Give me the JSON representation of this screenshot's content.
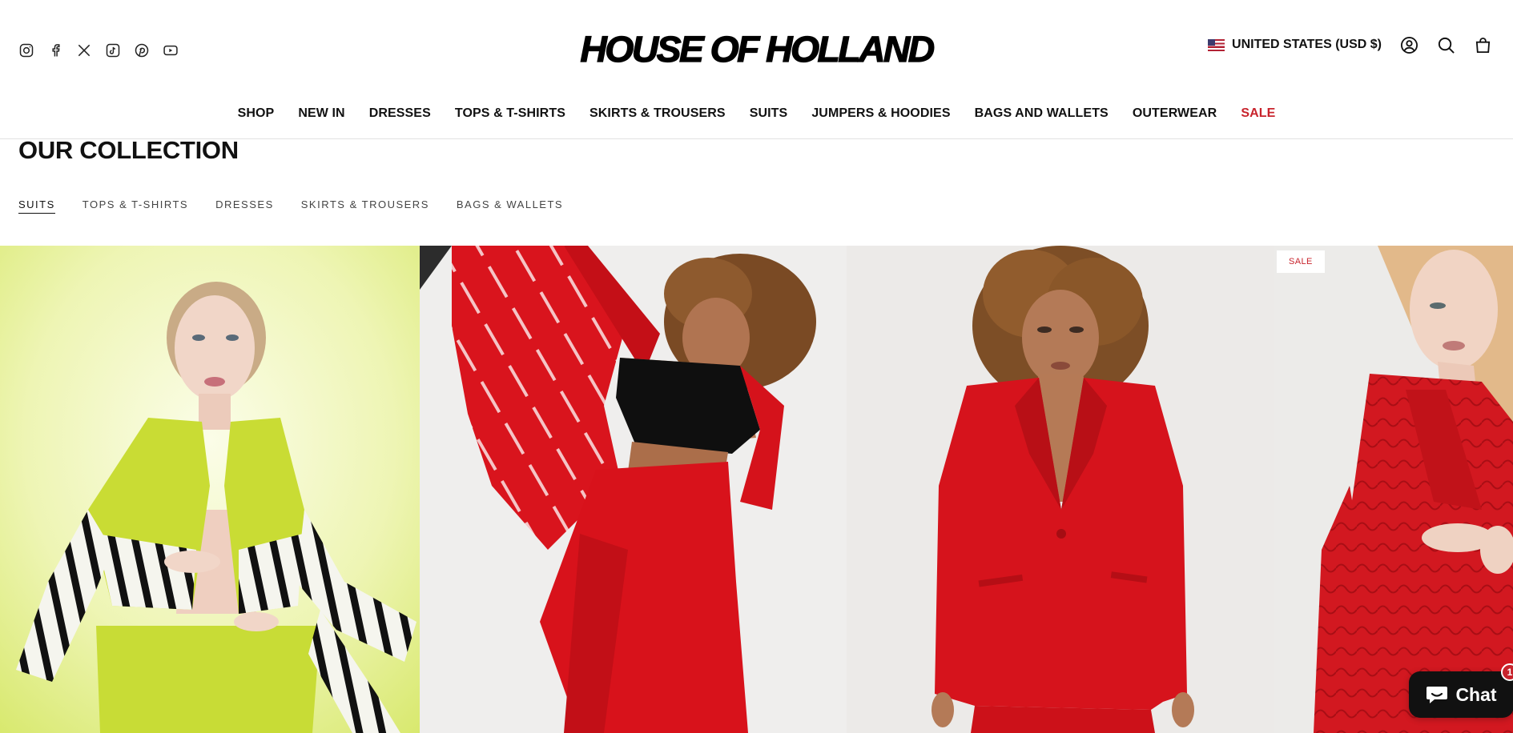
{
  "header": {
    "logo_text": "HOUSE OF HOLLAND",
    "socials": [
      "instagram-icon",
      "facebook-icon",
      "x-icon",
      "tiktok-icon",
      "pinterest-icon",
      "youtube-icon"
    ],
    "country_label": "UNITED STATES (USD $)",
    "utility_icons": [
      "account-icon",
      "search-icon",
      "cart-icon"
    ],
    "nav": [
      {
        "label": "SHOP"
      },
      {
        "label": "NEW IN"
      },
      {
        "label": "DRESSES"
      },
      {
        "label": "TOPS & T-SHIRTS"
      },
      {
        "label": "SKIRTS & TROUSERS"
      },
      {
        "label": "SUITS"
      },
      {
        "label": "JUMPERS & HOODIES"
      },
      {
        "label": "BAGS AND WALLETS"
      },
      {
        "label": "OUTERWEAR"
      },
      {
        "label": "SALE",
        "color": "#c8232c"
      }
    ]
  },
  "collection": {
    "title": "OUR COLLECTION",
    "tabs": [
      {
        "label": "SUITS",
        "active": true
      },
      {
        "label": "TOPS & T-SHIRTS"
      },
      {
        "label": "DRESSES"
      },
      {
        "label": "SKIRTS & TROUSERS"
      },
      {
        "label": "BAGS & WALLETS"
      }
    ]
  },
  "products": [
    {
      "image": "lime-cropped-blazer-suit"
    },
    {
      "image": "red-tailored-trouser-suit"
    },
    {
      "image": "red-single-button-blazer-suit"
    },
    {
      "image": "red-quilted-satin-blazer-suit",
      "badge": "SALE"
    }
  ],
  "chat": {
    "label": "Chat",
    "badge": "1"
  },
  "colors": {
    "sale": "#c8232c",
    "text": "#111111",
    "lime": "#c9dc34",
    "red": "#d8121b"
  }
}
